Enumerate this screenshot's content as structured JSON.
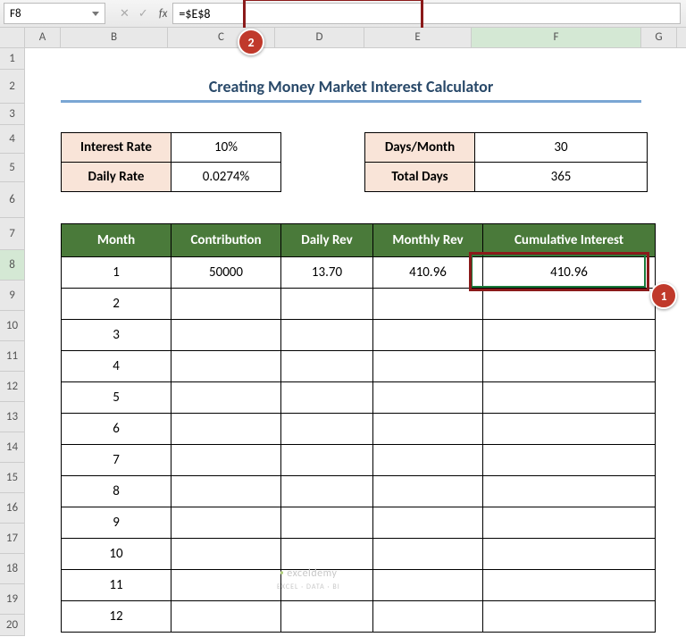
{
  "nameBox": "F8",
  "formula": "=$E$8",
  "columns": [
    "A",
    "B",
    "C",
    "D",
    "E",
    "F",
    "G"
  ],
  "rows": [
    "1",
    "2",
    "3",
    "4",
    "5",
    "6",
    "7",
    "8",
    "9",
    "10",
    "11",
    "12",
    "13",
    "14",
    "15",
    "16",
    "17",
    "18",
    "19",
    "20"
  ],
  "title": "Creating Money Market Interest Calculator",
  "paramsLeft": [
    {
      "label": "Interest Rate",
      "value": "10%"
    },
    {
      "label": "Daily Rate",
      "value": "0.0274%"
    }
  ],
  "paramsRight": [
    {
      "label": "Days/Month",
      "value": "30"
    },
    {
      "label": "Total Days",
      "value": "365"
    }
  ],
  "tableHeaders": [
    "Month",
    "Contribution",
    "Daily Rev",
    "Monthly Rev",
    "Cumulative Interest"
  ],
  "tableRows": [
    {
      "month": "1",
      "contribution": "50000",
      "daily": "13.70",
      "monthly": "410.96",
      "cumulative": "410.96"
    },
    {
      "month": "2",
      "contribution": "",
      "daily": "",
      "monthly": "",
      "cumulative": ""
    },
    {
      "month": "3",
      "contribution": "",
      "daily": "",
      "monthly": "",
      "cumulative": ""
    },
    {
      "month": "4",
      "contribution": "",
      "daily": "",
      "monthly": "",
      "cumulative": ""
    },
    {
      "month": "5",
      "contribution": "",
      "daily": "",
      "monthly": "",
      "cumulative": ""
    },
    {
      "month": "6",
      "contribution": "",
      "daily": "",
      "monthly": "",
      "cumulative": ""
    },
    {
      "month": "7",
      "contribution": "",
      "daily": "",
      "monthly": "",
      "cumulative": ""
    },
    {
      "month": "8",
      "contribution": "",
      "daily": "",
      "monthly": "",
      "cumulative": ""
    },
    {
      "month": "9",
      "contribution": "",
      "daily": "",
      "monthly": "",
      "cumulative": ""
    },
    {
      "month": "10",
      "contribution": "",
      "daily": "",
      "monthly": "",
      "cumulative": ""
    },
    {
      "month": "11",
      "contribution": "",
      "daily": "",
      "monthly": "",
      "cumulative": ""
    },
    {
      "month": "12",
      "contribution": "",
      "daily": "",
      "monthly": "",
      "cumulative": ""
    }
  ],
  "callouts": {
    "1": "1",
    "2": "2"
  },
  "watermark": {
    "main": "exceldemy",
    "sub": "EXCEL · DATA · BI"
  }
}
